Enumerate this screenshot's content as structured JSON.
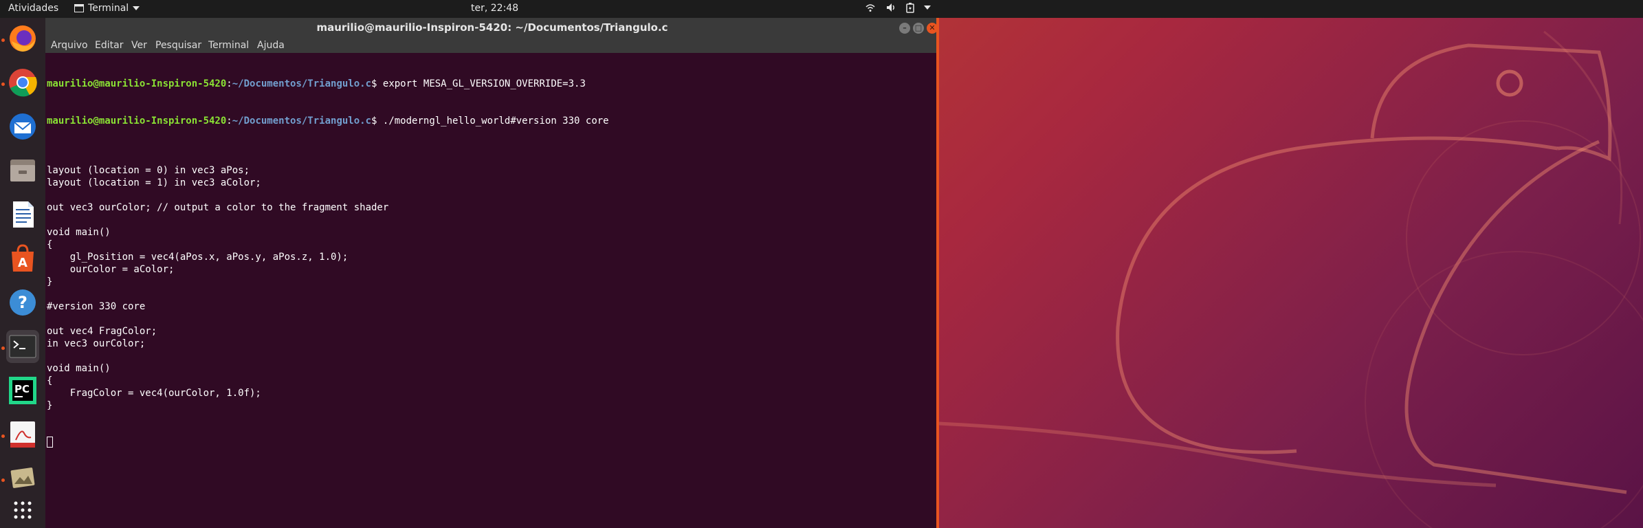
{
  "topbar": {
    "activities": "Atividades",
    "app_menu": "Terminal",
    "clock": "ter, 22:48"
  },
  "window": {
    "title": "maurilio@maurilio-Inspiron-5420: ~/Documentos/Triangulo.c",
    "menu": [
      "Arquivo",
      "Editar",
      "Ver",
      "Pesquisar",
      "Terminal",
      "Ajuda"
    ]
  },
  "terminal": {
    "prompt_user": "maurilio@maurilio-Inspiron-5420",
    "prompt_path": "~/Documentos/Triangulo.c",
    "prompt_sign": "$ ",
    "cmd1": "export MESA_GL_VERSION_OVERRIDE=3.3",
    "cmd2": "./moderngl_hello_world#version 330 core",
    "output": [
      "",
      "layout (location = 0) in vec3 aPos;",
      "layout (location = 1) in vec3 aColor;",
      "",
      "out vec3 ourColor; // output a color to the fragment shader",
      "",
      "void main()",
      "{",
      "    gl_Position = vec4(aPos.x, aPos.y, aPos.z, 1.0);",
      "    ourColor = aColor;",
      "}",
      "",
      "#version 330 core",
      "",
      "out vec4 FragColor;",
      "in vec3 ourColor;",
      "",
      "void main()",
      "{",
      "    FragColor = vec4(ourColor, 1.0f);",
      "}"
    ]
  },
  "dock": {
    "items": [
      "firefox-icon",
      "chrome-icon",
      "thunderbird-icon",
      "files-icon",
      "writer-icon",
      "software-icon",
      "help-icon",
      "terminal-icon",
      "pycharm-icon",
      "pdf-viewer-icon",
      "image-viewer-icon",
      "show-apps-icon"
    ]
  },
  "colors": {
    "accent": "#e95420",
    "terminal_bg": "#300a24",
    "prompt_user": "#8ae234",
    "prompt_path": "#729fcf"
  }
}
